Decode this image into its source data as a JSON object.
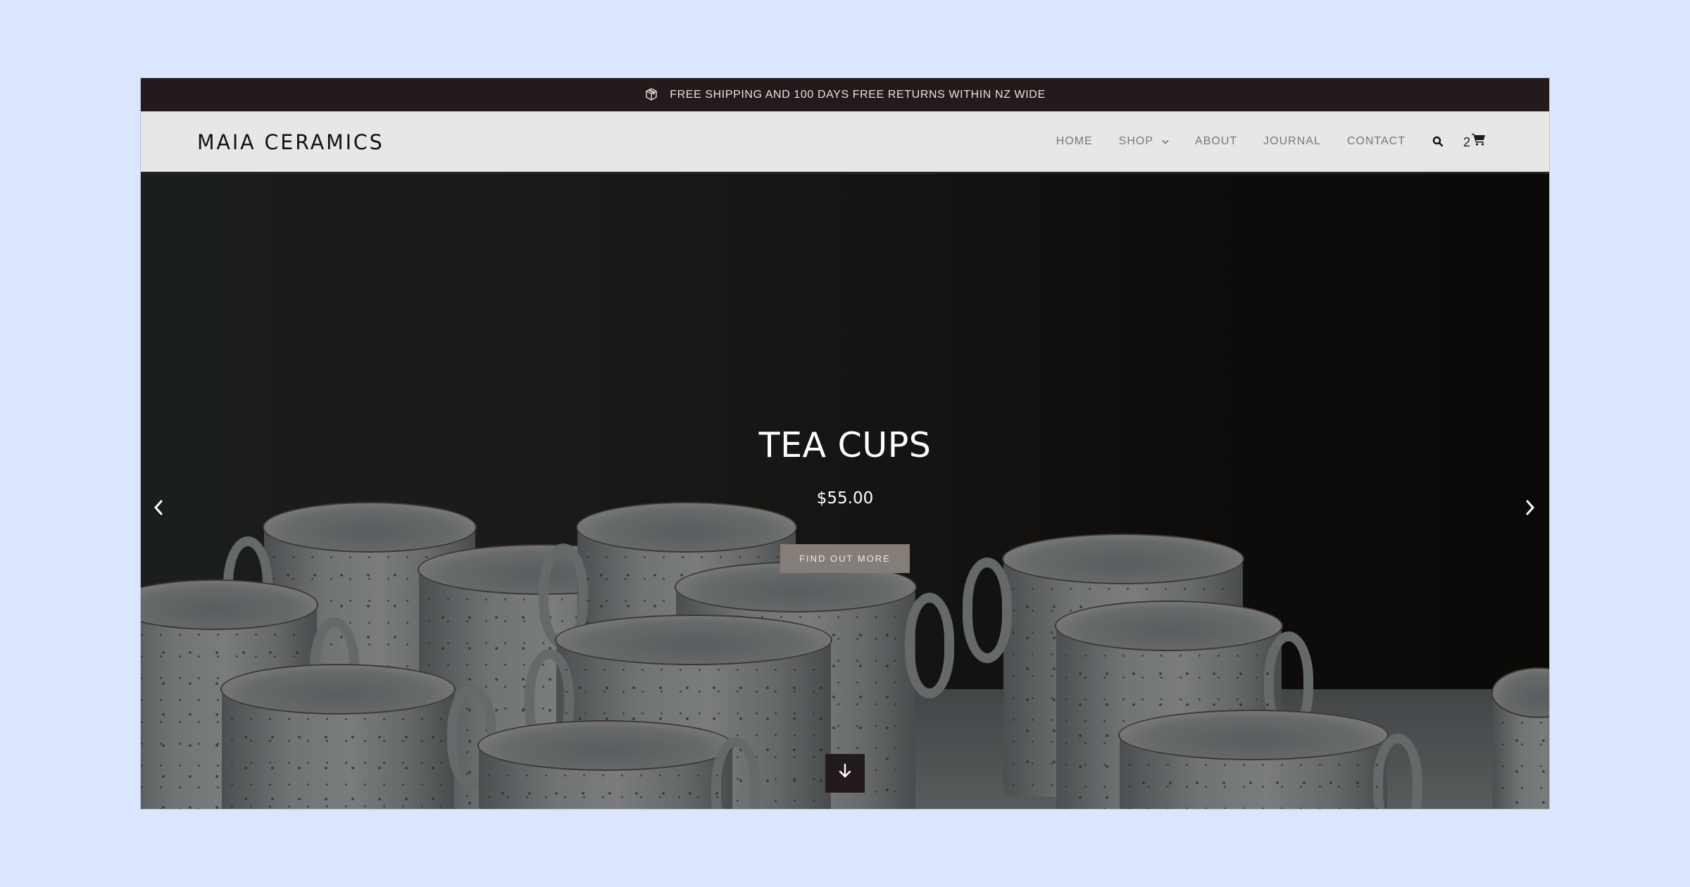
{
  "announcement": {
    "icon": "package-box-icon",
    "text": "FREE SHIPPING AND 100 DAYS FREE RETURNS WITHIN NZ WIDE"
  },
  "header": {
    "logo": "MAIA CERAMICS",
    "nav": [
      {
        "label": "HOME"
      },
      {
        "label": "SHOP",
        "has_dropdown": true
      },
      {
        "label": "ABOUT"
      },
      {
        "label": "JOURNAL"
      },
      {
        "label": "CONTACT"
      }
    ],
    "search_icon": "search-icon",
    "cart": {
      "count": "2",
      "icon": "shopping-cart-icon"
    }
  },
  "hero": {
    "title": "TEA CUPS",
    "price": "$55.00",
    "button_label": "FIND OUT MORE",
    "prev_icon": "chevron-left-icon",
    "next_icon": "chevron-right-icon",
    "scroll_icon": "arrow-down-icon",
    "image_description": "white speckled ceramic tea cups on dark background"
  },
  "colors": {
    "page_background": "#dce5fe",
    "announcement_bar": "#231b1b",
    "header_background": "#e7e7e5",
    "nav_text": "#7b7675",
    "button_background": "#857d78",
    "scroll_button": "#231b1b"
  }
}
